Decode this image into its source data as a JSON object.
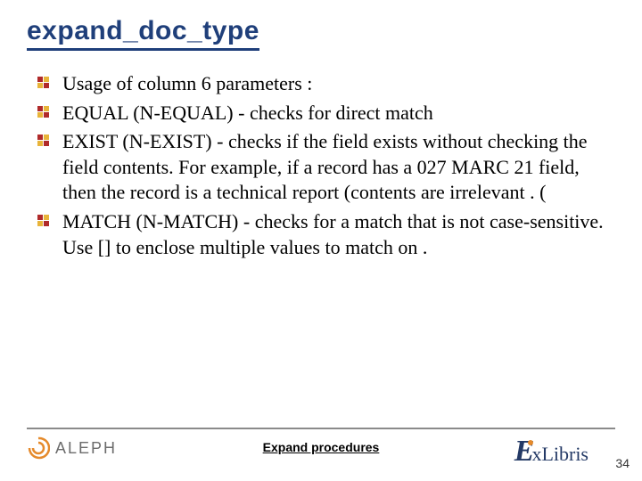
{
  "title": "expand_doc_type",
  "items": [
    "Usage of column 6 parameters :",
    "EQUAL (N-EQUAL) - checks for direct match",
    "EXIST (N-EXIST) - checks if the field exists without checking the field contents. For example, if a record has a 027 MARC 21 field, then the record is a technical report (contents are irrelevant . (",
    "MATCH (N-MATCH) - checks for a match that is not case-sensitive. Use [] to enclose multiple values to match on ."
  ],
  "footer": {
    "left_logo": "ALEPH",
    "center": "Expand procedures",
    "right_logo_prefix": "E",
    "right_logo_rest": "xLibris"
  },
  "page_number": "34"
}
